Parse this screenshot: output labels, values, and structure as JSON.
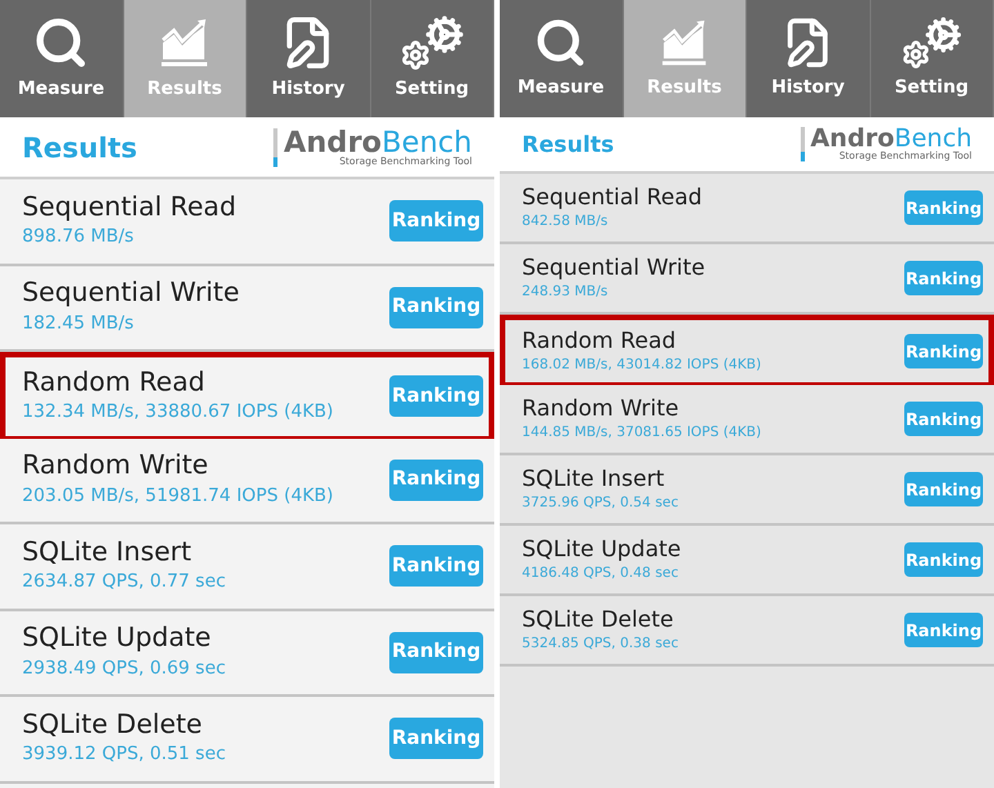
{
  "screens": [
    {
      "tabs": [
        {
          "label": "Measure",
          "selected": false
        },
        {
          "label": "Results",
          "selected": true
        },
        {
          "label": "History",
          "selected": false
        },
        {
          "label": "Setting",
          "selected": false
        }
      ],
      "header": {
        "title": "Results",
        "logo_dark": "Andro",
        "logo_accent": "Bench",
        "tagline": "Storage Benchmarking Tool"
      },
      "results": [
        {
          "name": "Sequential Read",
          "value": "898.76 MB/s",
          "button": "Ranking",
          "highlighted": false
        },
        {
          "name": "Sequential Write",
          "value": "182.45 MB/s",
          "button": "Ranking",
          "highlighted": false
        },
        {
          "name": "Random Read",
          "value": "132.34 MB/s, 33880.67 IOPS (4KB)",
          "button": "Ranking",
          "highlighted": true
        },
        {
          "name": "Random Write",
          "value": "203.05 MB/s, 51981.74 IOPS (4KB)",
          "button": "Ranking",
          "highlighted": false
        },
        {
          "name": "SQLite Insert",
          "value": "2634.87 QPS, 0.77 sec",
          "button": "Ranking",
          "highlighted": false
        },
        {
          "name": "SQLite Update",
          "value": "2938.49 QPS, 0.69 sec",
          "button": "Ranking",
          "highlighted": false
        },
        {
          "name": "SQLite Delete",
          "value": "3939.12 QPS, 0.51 sec",
          "button": "Ranking",
          "highlighted": false
        }
      ]
    },
    {
      "tabs": [
        {
          "label": "Measure",
          "selected": false
        },
        {
          "label": "Results",
          "selected": true
        },
        {
          "label": "History",
          "selected": false
        },
        {
          "label": "Setting",
          "selected": false
        }
      ],
      "header": {
        "title": "Results",
        "logo_dark": "Andro",
        "logo_accent": "Bench",
        "tagline": "Storage Benchmarking Tool"
      },
      "results": [
        {
          "name": "Sequential Read",
          "value": "842.58 MB/s",
          "button": "Ranking",
          "highlighted": false
        },
        {
          "name": "Sequential Write",
          "value": "248.93 MB/s",
          "button": "Ranking",
          "highlighted": false
        },
        {
          "name": "Random Read",
          "value": "168.02 MB/s, 43014.82 IOPS (4KB)",
          "button": "Ranking",
          "highlighted": true
        },
        {
          "name": "Random Write",
          "value": "144.85 MB/s, 37081.65 IOPS (4KB)",
          "button": "Ranking",
          "highlighted": false
        },
        {
          "name": "SQLite Insert",
          "value": "3725.96 QPS, 0.54 sec",
          "button": "Ranking",
          "highlighted": false
        },
        {
          "name": "SQLite Update",
          "value": "4186.48 QPS, 0.48 sec",
          "button": "Ranking",
          "highlighted": false
        },
        {
          "name": "SQLite Delete",
          "value": "5324.85 QPS, 0.38 sec",
          "button": "Ranking",
          "highlighted": false
        }
      ]
    }
  ]
}
